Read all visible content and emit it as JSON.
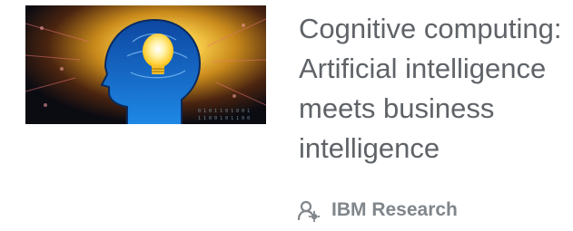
{
  "article": {
    "title": "Cognitive computing:\nArtificial intelligence\nmeets business\nintelligence",
    "source": {
      "name": "IBM Research",
      "icon": "user-group-icon"
    },
    "thumbnail": {
      "icon": "ai-head-lightbulb-image"
    }
  },
  "colors": {
    "title": "#5f6368",
    "source": "#80868b",
    "thumb_glow": "#ffd54f",
    "thumb_head": "#1565c0"
  }
}
